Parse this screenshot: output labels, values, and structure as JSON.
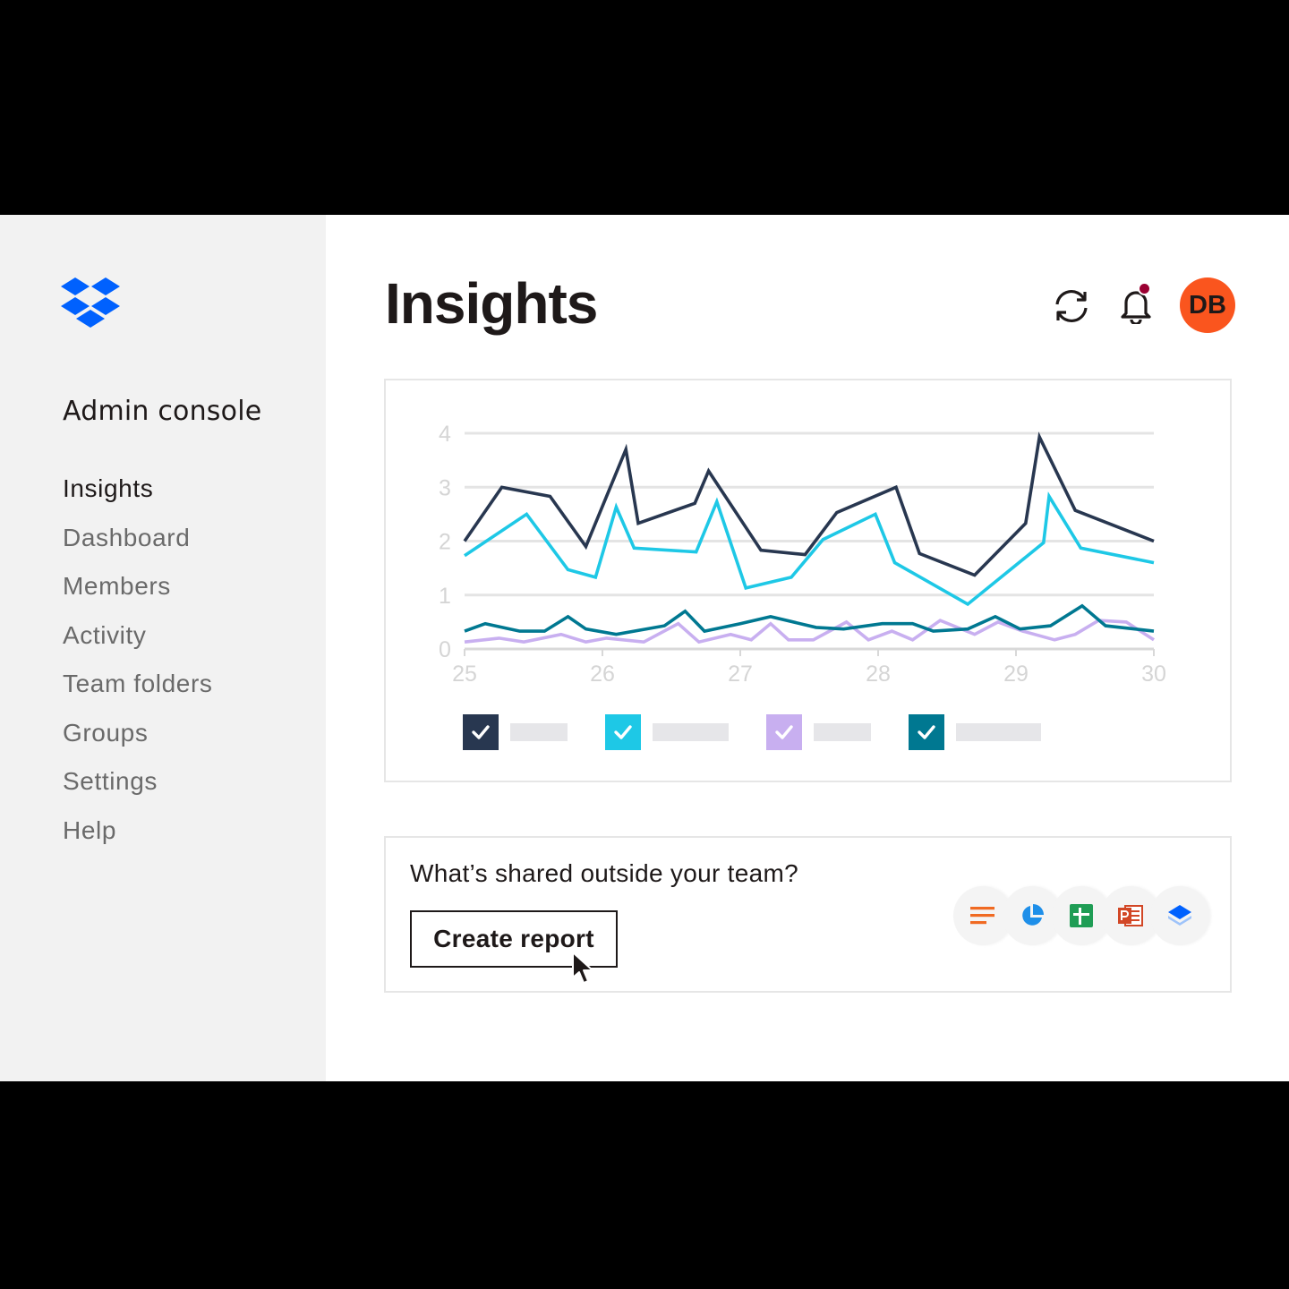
{
  "sidebar": {
    "title": "Admin console",
    "items": [
      {
        "label": "Insights",
        "active": true
      },
      {
        "label": "Dashboard"
      },
      {
        "label": "Members"
      },
      {
        "label": "Activity"
      },
      {
        "label": "Team folders"
      },
      {
        "label": "Groups"
      },
      {
        "label": "Settings"
      },
      {
        "label": "Help"
      }
    ]
  },
  "header": {
    "title": "Insights",
    "icons": [
      "sync-icon",
      "bell-icon"
    ],
    "avatar_initials": "DB",
    "avatar_color": "#fa551e",
    "notification_color": "#9b0032"
  },
  "chart_data": {
    "type": "line",
    "x_ticks": [
      "25",
      "26",
      "27",
      "28",
      "29",
      "30"
    ],
    "y_ticks": [
      "0",
      "1",
      "2",
      "3",
      "4"
    ],
    "xlim": [
      25,
      30
    ],
    "ylim": [
      0,
      4
    ],
    "grid": true,
    "legend_position": "bottom",
    "series": [
      {
        "color": "#283750",
        "x": [
          25,
          25.27,
          25.62,
          25.88,
          26.17,
          26.26,
          26.67,
          26.77,
          27.15,
          27.47,
          27.7,
          28.13,
          28.3,
          28.7,
          29.07,
          29.17,
          29.43,
          30
        ],
        "y": [
          2.0,
          3.0,
          2.83,
          1.9,
          3.7,
          2.33,
          2.7,
          3.3,
          1.83,
          1.75,
          2.53,
          3.0,
          1.77,
          1.37,
          2.33,
          3.93,
          2.57,
          2.0
        ]
      },
      {
        "color": "#1ec8e6",
        "x": [
          25,
          25.45,
          25.75,
          25.95,
          26.1,
          26.23,
          26.68,
          26.83,
          27.04,
          27.37,
          27.6,
          27.98,
          28.12,
          28.65,
          29.2,
          29.24,
          29.47,
          30
        ],
        "y": [
          1.73,
          2.5,
          1.47,
          1.33,
          2.63,
          1.87,
          1.8,
          2.73,
          1.13,
          1.33,
          2.03,
          2.5,
          1.6,
          0.83,
          1.97,
          2.83,
          1.87,
          1.6
        ]
      },
      {
        "color": "#c8aff0",
        "x": [
          25,
          25.25,
          25.43,
          25.7,
          25.88,
          26.03,
          26.3,
          26.55,
          26.7,
          26.93,
          27.08,
          27.22,
          27.35,
          27.53,
          27.77,
          27.93,
          28.1,
          28.25,
          28.45,
          28.7,
          28.87,
          29.05,
          29.28,
          29.43,
          29.6,
          29.8,
          30
        ],
        "y": [
          0.13,
          0.2,
          0.13,
          0.27,
          0.13,
          0.2,
          0.13,
          0.47,
          0.13,
          0.27,
          0.17,
          0.47,
          0.17,
          0.17,
          0.5,
          0.17,
          0.33,
          0.17,
          0.53,
          0.27,
          0.5,
          0.33,
          0.17,
          0.27,
          0.53,
          0.5,
          0.17
        ]
      },
      {
        "color": "#007891",
        "x": [
          25,
          25.15,
          25.4,
          25.58,
          25.75,
          25.88,
          26.1,
          26.45,
          26.6,
          26.74,
          27.0,
          27.22,
          27.55,
          27.75,
          28.03,
          28.25,
          28.4,
          28.65,
          28.85,
          29.03,
          29.25,
          29.48,
          29.65,
          30
        ],
        "y": [
          0.33,
          0.47,
          0.33,
          0.33,
          0.6,
          0.37,
          0.27,
          0.43,
          0.7,
          0.33,
          0.47,
          0.6,
          0.4,
          0.37,
          0.47,
          0.47,
          0.33,
          0.37,
          0.6,
          0.37,
          0.43,
          0.8,
          0.43,
          0.33
        ]
      }
    ]
  },
  "legend": {
    "items": [
      {
        "color": "#283750",
        "bar_width": 64
      },
      {
        "color": "#1ec8e6",
        "bar_width": 85
      },
      {
        "color": "#c8aff0",
        "bar_width": 64
      },
      {
        "color": "#007891",
        "bar_width": 95
      }
    ]
  },
  "report": {
    "question": "What’s shared outside your team?",
    "button_label": "Create report",
    "file_icons": [
      "document-icon",
      "pie-chart-icon",
      "spreadsheet-icon",
      "powerpoint-icon",
      "dropbox-icon"
    ]
  }
}
